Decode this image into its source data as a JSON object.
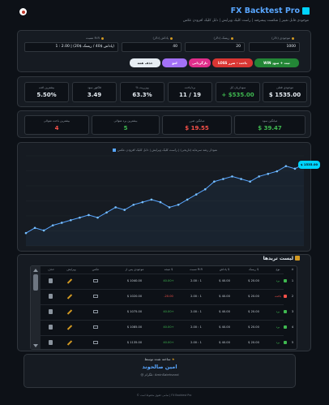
{
  "header": {
    "title": "FX Backtest Pro",
    "subtitle": "موجودی قابل تغییر | شکست پیشرفته | راست کلیک ویرایش | دابل کلیک افزودن عکس"
  },
  "settings": {
    "initial_balance": {
      "label": "موجودی (دلار)",
      "value": "1000"
    },
    "risk": {
      "label": "ریسک (دلار)",
      "value": "20"
    },
    "reward": {
      "label": "پاداش (دلار)",
      "value": "40"
    },
    "rr": {
      "label": "نسبت R:R",
      "value": "1 : 2.00 | (پاداش $40 / ریسک $20)"
    },
    "buttons": {
      "win": "WIN ثبت + سود",
      "loss": "LOSS باخت - ضرر",
      "undo": "لغو",
      "pink": "بازگردانی",
      "clear": "حذف همه"
    }
  },
  "stats": [
    {
      "label": "موجودی فعلی",
      "value": "$ 1535.00",
      "tone": "normal"
    },
    {
      "label": "سود/زیان کل",
      "value": "+ $535.00",
      "tone": "green"
    },
    {
      "label": "برد/باخت",
      "value": "11 / 19",
      "tone": "normal"
    },
    {
      "label": "% وین‌ریت",
      "value": "63.3%",
      "tone": "normal"
    },
    {
      "label": "فاکتور سود",
      "value": "3.49",
      "tone": "normal"
    },
    {
      "label": "بیشترین افت",
      "value": "5.50%",
      "tone": "normal"
    }
  ],
  "stats2": [
    {
      "label": "میانگین سود",
      "value": "$ 39.47",
      "tone": "green"
    },
    {
      "label": "میانگین ضرر",
      "value": "$ 19.55",
      "tone": "red"
    },
    {
      "label": "بیشترین برد متوالی",
      "value": "5",
      "tone": "green"
    },
    {
      "label": "بیشترین باخت متوالی",
      "value": "4",
      "tone": "red"
    }
  ],
  "chart_data": {
    "type": "line",
    "legend": "نمودار رشد سرمایه (تاریخی) | راست کلیک ویرایش | دابل کلیک افزودن عکس",
    "series": [
      {
        "values": [
          1000,
          1040,
          1020,
          1060,
          1080,
          1100,
          1120,
          1140,
          1120,
          1160,
          1200,
          1180,
          1220,
          1240,
          1260,
          1240,
          1200,
          1220,
          1260,
          1300,
          1340,
          1400,
          1420,
          1440,
          1420,
          1400,
          1440,
          1460,
          1480,
          1520,
          1500,
          1535
        ]
      }
    ],
    "ylim": [
      900,
      1600
    ],
    "last_label": "$ 1535.00"
  },
  "table": {
    "title": "لیست تریدها",
    "columns": [
      "#",
      "نوع",
      "ریسک $",
      "پاداش $",
      "نسبت R:R",
      "نتیجه $",
      "موجودی پس از",
      "عکس",
      "ویرایش",
      "حذف"
    ],
    "rows": [
      {
        "n": "1",
        "type": "برد",
        "risk": "$ 20.00",
        "reward": "$ 40.00",
        "rr": "2.00 : 1",
        "result": "40.00+",
        "balance": "$ 1040.00",
        "win": true
      },
      {
        "n": "2",
        "type": "باخت",
        "risk": "$ 20.00",
        "reward": "$ 40.00",
        "rr": "2.00 : 1",
        "result": "-20.00",
        "balance": "$ 1020.00",
        "win": false
      },
      {
        "n": "3",
        "type": "برد",
        "risk": "$ 20.00",
        "reward": "$ 40.00",
        "rr": "2.00 : 1",
        "result": "40.00+",
        "balance": "$ 1075.00",
        "win": true
      },
      {
        "n": "4",
        "type": "برد",
        "risk": "$ 20.00",
        "reward": "$ 40.00",
        "rr": "2.00 : 1",
        "result": "40.00+",
        "balance": "$ 1085.00",
        "win": true
      },
      {
        "n": "5",
        "type": "برد",
        "risk": "$ 20.00",
        "reward": "$ 40.00",
        "rr": "2.00 : 1",
        "result": "40.00+",
        "balance": "$ 1135.00",
        "win": true
      }
    ]
  },
  "footer": {
    "made_by": "ساخته شده توسط",
    "name": "امین صالحوند",
    "handle": "@ تلگرام: AminSalehvand",
    "copyright": "© تمامی حقوق محفوظ است | FX Backtest Pro"
  },
  "colors": {
    "accent": "#58a6ff",
    "cyan": "#00d4ff",
    "win": "#3fb950",
    "loss": "#f85149",
    "bg": "#0d1117",
    "panel": "#161b22"
  }
}
